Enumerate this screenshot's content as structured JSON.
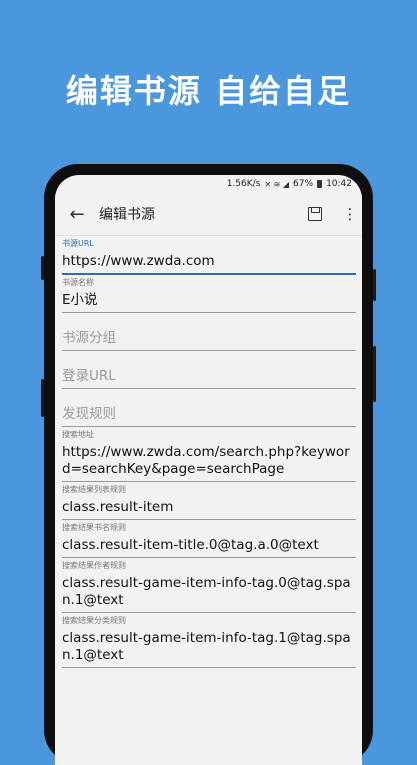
{
  "promo": {
    "headline": "编辑书源  自给自足"
  },
  "status_bar": {
    "speed": "1.56K/s",
    "signal_icons": "✕ ≋ ◢",
    "battery_pct": "67%",
    "time": "10:42"
  },
  "toolbar": {
    "title": "编辑书源"
  },
  "fields": [
    {
      "label": "书源URL",
      "value": "https://www.zwda.com"
    },
    {
      "label": "书源名称",
      "value": "E小说"
    },
    {
      "placeholder": "书源分组"
    },
    {
      "placeholder": "登录URL"
    },
    {
      "placeholder": "发现规则"
    },
    {
      "label": "搜索地址",
      "value": "https://www.zwda.com/search.php?keyword=searchKey&page=searchPage"
    },
    {
      "label": "搜索结果列表规则",
      "value": "class.result-item"
    },
    {
      "label": "搜索结果书名规则",
      "value": "class.result-item-title.0@tag.a.0@text"
    },
    {
      "label": "搜索结果作者规则",
      "value": "class.result-game-item-info-tag.0@tag.span.1@text"
    },
    {
      "label": "搜索结果分类规则",
      "value": "class.result-game-item-info-tag.1@tag.span.1@text"
    }
  ],
  "colors": {
    "background": "#4a97de",
    "accent": "#2b6fb8"
  }
}
